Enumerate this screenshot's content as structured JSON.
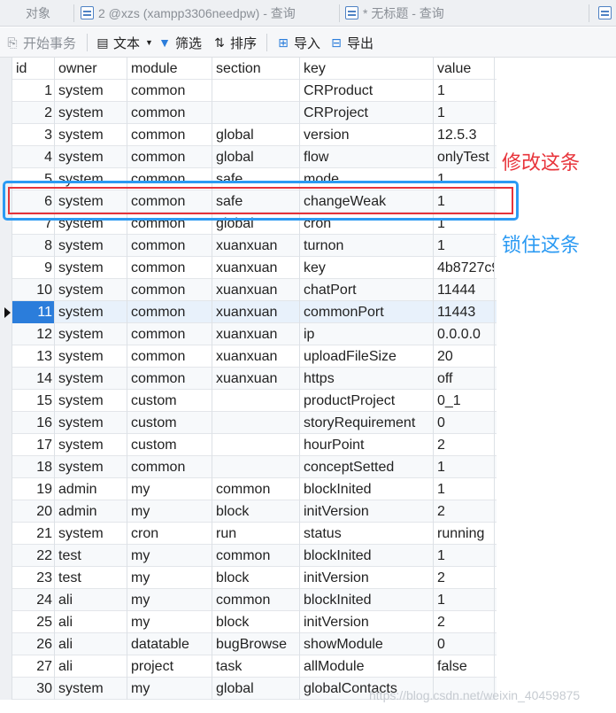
{
  "tabs": [
    {
      "label": "对象"
    },
    {
      "label": "2 @xzs (xampp3306needpw) - 查询"
    },
    {
      "label": "* 无标题 - 查询"
    }
  ],
  "toolbar": {
    "begin_transaction": "开始事务",
    "text": "文本",
    "filter": "筛选",
    "sort": "排序",
    "import": "导入",
    "export": "导出"
  },
  "table": {
    "columns": [
      "id",
      "owner",
      "module",
      "section",
      "key",
      "value"
    ],
    "rows": [
      [
        "1",
        "system",
        "common",
        "",
        "CRProduct",
        "1"
      ],
      [
        "2",
        "system",
        "common",
        "",
        "CRProject",
        "1"
      ],
      [
        "3",
        "system",
        "common",
        "global",
        "version",
        "12.5.3"
      ],
      [
        "4",
        "system",
        "common",
        "global",
        "flow",
        "onlyTest"
      ],
      [
        "5",
        "system",
        "common",
        "safe",
        "mode",
        "1"
      ],
      [
        "6",
        "system",
        "common",
        "safe",
        "changeWeak",
        "1"
      ],
      [
        "7",
        "system",
        "common",
        "global",
        "cron",
        "1"
      ],
      [
        "8",
        "system",
        "common",
        "xuanxuan",
        "turnon",
        "1"
      ],
      [
        "9",
        "system",
        "common",
        "xuanxuan",
        "key",
        "4b8727c9"
      ],
      [
        "10",
        "system",
        "common",
        "xuanxuan",
        "chatPort",
        "11444"
      ],
      [
        "11",
        "system",
        "common",
        "xuanxuan",
        "commonPort",
        "11443"
      ],
      [
        "12",
        "system",
        "common",
        "xuanxuan",
        "ip",
        "0.0.0.0"
      ],
      [
        "13",
        "system",
        "common",
        "xuanxuan",
        "uploadFileSize",
        "20"
      ],
      [
        "14",
        "system",
        "common",
        "xuanxuan",
        "https",
        "off"
      ],
      [
        "15",
        "system",
        "custom",
        "",
        "productProject",
        "0_1"
      ],
      [
        "16",
        "system",
        "custom",
        "",
        "storyRequirement",
        "0"
      ],
      [
        "17",
        "system",
        "custom",
        "",
        "hourPoint",
        "2"
      ],
      [
        "18",
        "system",
        "common",
        "",
        "conceptSetted",
        "1"
      ],
      [
        "19",
        "admin",
        "my",
        "common",
        "blockInited",
        "1"
      ],
      [
        "20",
        "admin",
        "my",
        "block",
        "initVersion",
        "2"
      ],
      [
        "21",
        "system",
        "cron",
        "run",
        "status",
        "running"
      ],
      [
        "22",
        "test",
        "my",
        "common",
        "blockInited",
        "1"
      ],
      [
        "23",
        "test",
        "my",
        "block",
        "initVersion",
        "2"
      ],
      [
        "24",
        "ali",
        "my",
        "common",
        "blockInited",
        "1"
      ],
      [
        "25",
        "ali",
        "my",
        "block",
        "initVersion",
        "2"
      ],
      [
        "26",
        "ali",
        "datatable",
        "bugBrowse",
        "showModule",
        "0"
      ],
      [
        "27",
        "ali",
        "project",
        "task",
        "allModule",
        "false"
      ],
      [
        "30",
        "system",
        "my",
        "global",
        "globalContacts",
        ""
      ]
    ],
    "selected_row_id": "11"
  },
  "annotations": {
    "modify": "修改这条",
    "lock": "锁住这条"
  },
  "watermark": "https://blog.csdn.net/weixin_40459875",
  "colors": {
    "selection": "#2b7ddb",
    "annotation_red": "#e8343b",
    "annotation_blue": "#2b9af3"
  }
}
